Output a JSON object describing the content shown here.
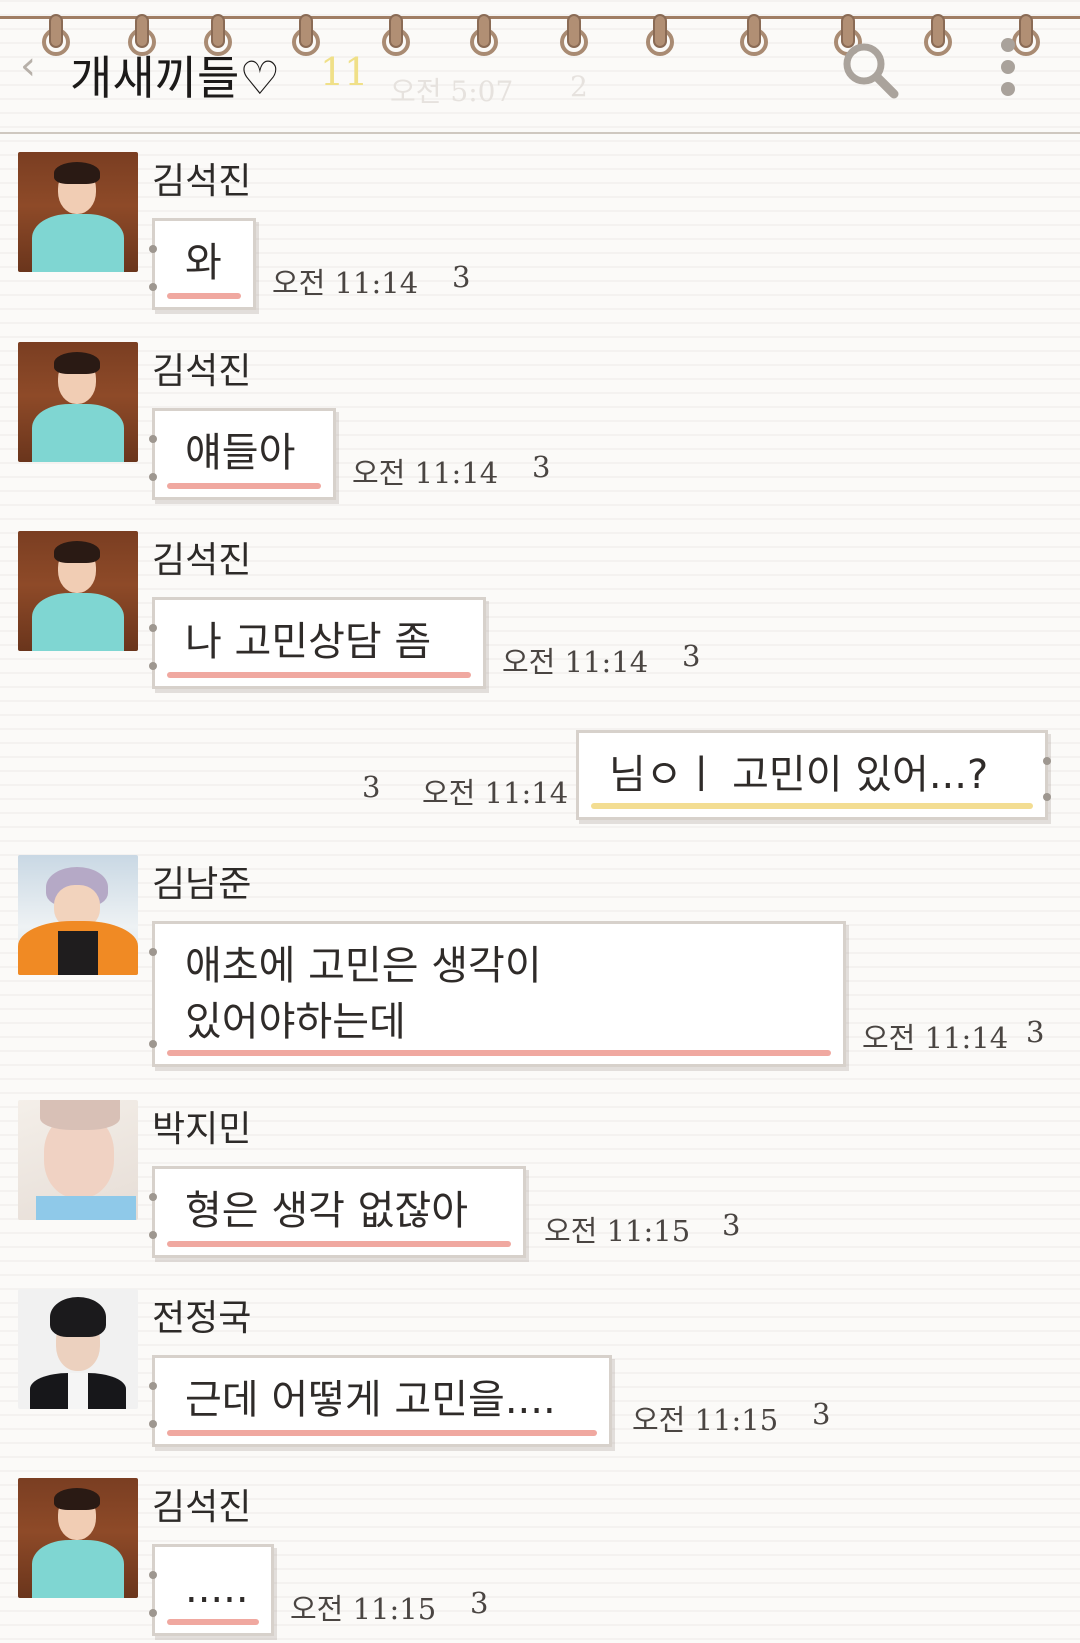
{
  "header": {
    "back_icon": "chevron-left-icon",
    "title": "개새끼들♡",
    "member_count": "11",
    "faint_time": "오전 5:07",
    "faint_count": "2",
    "search_icon": "search-icon",
    "menu_icon": "more-vertical-icon"
  },
  "messages": [
    {
      "sender": "김석진",
      "text": "와",
      "time": "오전 11:14",
      "unread": "3"
    },
    {
      "sender": "김석진",
      "text": "얘들아",
      "time": "오전 11:14",
      "unread": "3"
    },
    {
      "sender": "김석진",
      "text": "나 고민상담 좀",
      "time": "오전 11:14",
      "unread": "3"
    },
    {
      "sender": "",
      "text": "님ㅇㅣ 고민이 있어...?",
      "time": "오전 11:14",
      "unread": "3",
      "mine": true
    },
    {
      "sender": "김남준",
      "text_lines": [
        "애초에 고민은 생각이",
        "있어야하는데"
      ],
      "time": "오전 11:14",
      "unread": "3"
    },
    {
      "sender": "박지민",
      "text": "형은 생각 없잖아",
      "time": "오전 11:15",
      "unread": "3"
    },
    {
      "sender": "전정국",
      "text": "근데 어떻게 고민을....",
      "time": "오전 11:15",
      "unread": "3"
    },
    {
      "sender": "김석진",
      "text": ".....",
      "time": "오전 11:15",
      "unread": "3"
    }
  ],
  "colors": {
    "underline_other": "#f0a8a0",
    "underline_mine": "#f3dd92",
    "ring": "#a98b73"
  }
}
